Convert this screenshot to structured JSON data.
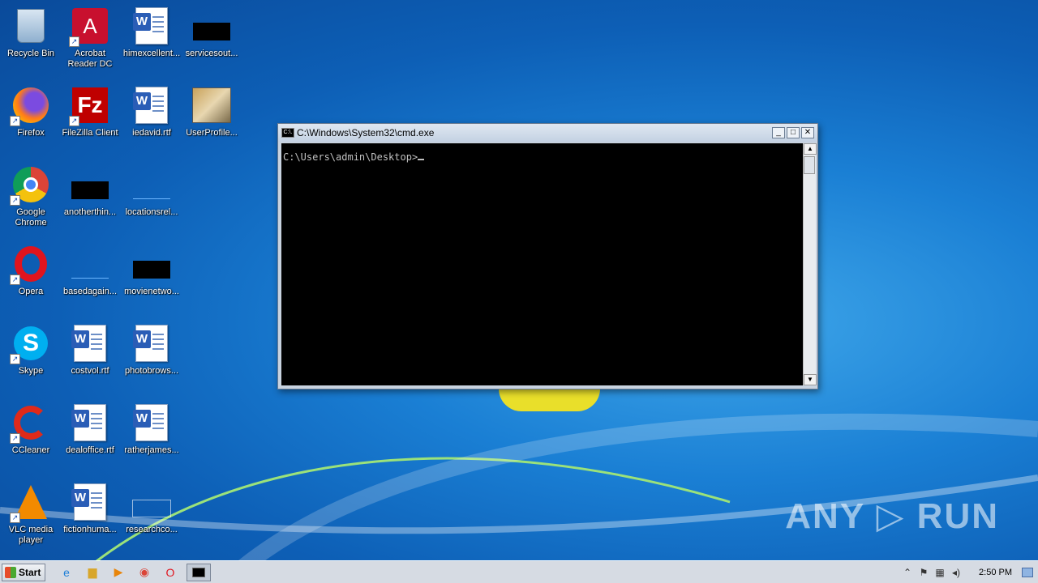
{
  "desktop": {
    "icons": [
      {
        "label": "Recycle Bin"
      },
      {
        "label": "Acrobat Reader DC"
      },
      {
        "label": "himexcellent..."
      },
      {
        "label": "servicesout..."
      },
      {
        "label": "Firefox"
      },
      {
        "label": "FileZilla Client"
      },
      {
        "label": "iedavid.rtf"
      },
      {
        "label": "UserProfile..."
      },
      {
        "label": "Google Chrome"
      },
      {
        "label": "anotherthin..."
      },
      {
        "label": "locationsrel..."
      },
      {
        "label": "Opera"
      },
      {
        "label": "basedagain..."
      },
      {
        "label": "movienetwo..."
      },
      {
        "label": "Skype"
      },
      {
        "label": "costvol.rtf"
      },
      {
        "label": "photobrows..."
      },
      {
        "label": "CCleaner"
      },
      {
        "label": "dealoffice.rtf"
      },
      {
        "label": "ratherjames..."
      },
      {
        "label": "VLC media player"
      },
      {
        "label": "fictionhuma..."
      },
      {
        "label": "researchco..."
      }
    ]
  },
  "cmd": {
    "title": "C:\\Windows\\System32\\cmd.exe",
    "icon_text": "C:\\.",
    "prompt": "C:\\Users\\admin\\Desktop>",
    "minimize_glyph": "_",
    "maximize_glyph": "□",
    "close_glyph": "✕"
  },
  "taskbar": {
    "start_label": "Start",
    "clock": "2:50 PM",
    "pinned": [
      {
        "name": "internet-explorer-icon"
      },
      {
        "name": "file-explorer-icon"
      },
      {
        "name": "media-player-icon"
      },
      {
        "name": "chrome-icon"
      },
      {
        "name": "opera-icon"
      },
      {
        "name": "cmd-icon"
      }
    ]
  },
  "watermark": "ANY ▷ RUN"
}
